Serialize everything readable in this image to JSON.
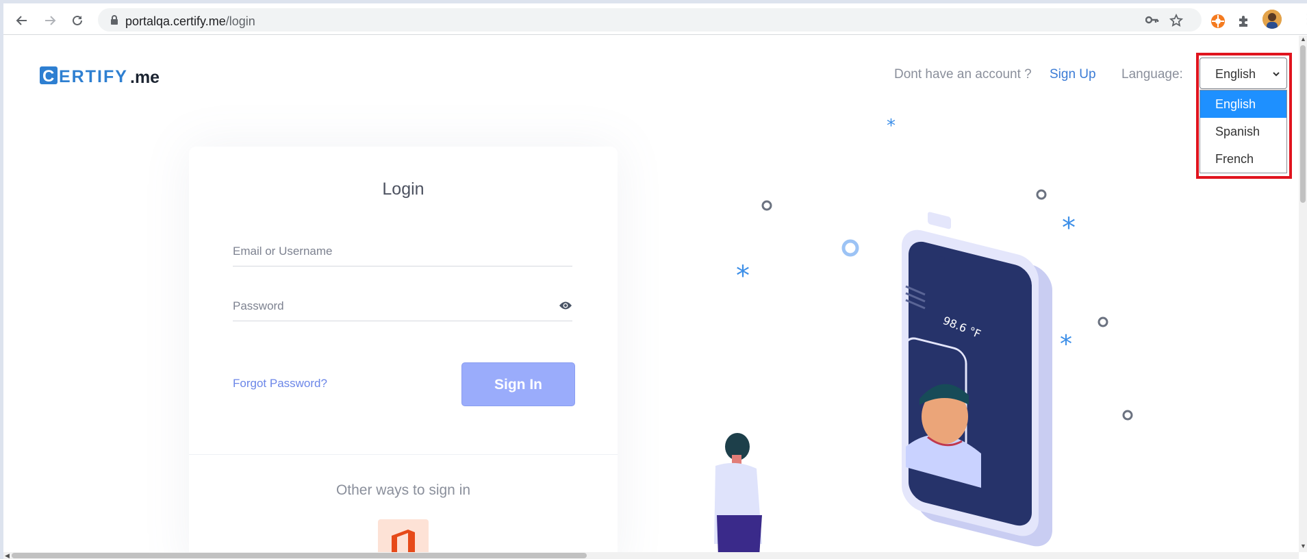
{
  "browser": {
    "url_host": "portalqa.certify.me",
    "url_path": "/login",
    "icons": [
      "back-icon",
      "forward-icon",
      "reload-icon",
      "lock-icon",
      "key-icon",
      "star-icon",
      "extension-icon",
      "puzzle-icon",
      "avatar",
      "menu-icon"
    ]
  },
  "header": {
    "logo_c": "C",
    "logo_rest": "ERTIFY",
    "logo_suffix": ".me",
    "account_prompt": "Dont have an account ?",
    "signup_link": "Sign Up",
    "language_label": "Language:",
    "language_selected": "English",
    "language_options": [
      "English",
      "Spanish",
      "French"
    ]
  },
  "login": {
    "title": "Login",
    "email_placeholder": "Email or Username",
    "password_placeholder": "Password",
    "forgot_link": "Forgot Password?",
    "signin_button": "Sign In",
    "other_ways": "Other ways to sign in"
  },
  "illustration": {
    "temperature": "98.6 °F"
  },
  "colors": {
    "brand_blue": "#3a7bd5",
    "signin_button": "#9aacfb",
    "dropdown_selected": "#1e90ff",
    "highlight_border": "#e0141e",
    "phone_body": "#26336a",
    "office_orange": "#e64a19"
  }
}
